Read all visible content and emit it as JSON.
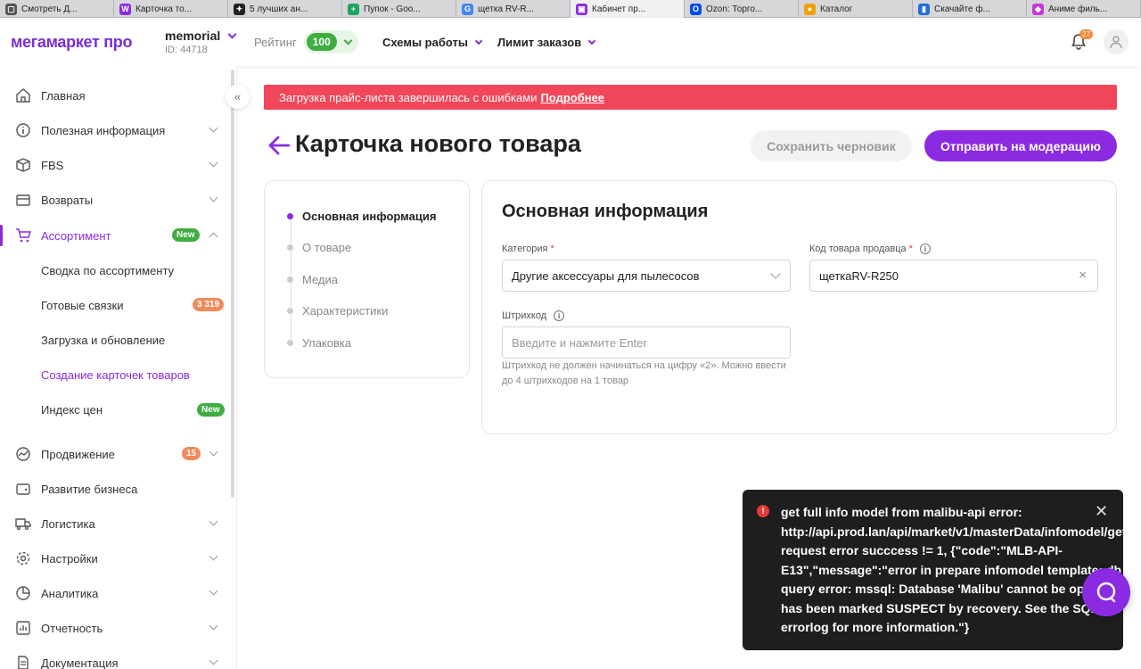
{
  "browser_tabs": [
    {
      "label": "Смотреть Д...",
      "color": "#555555",
      "glyph": "▢"
    },
    {
      "label": "Карточка то...",
      "color": "#8a2be2",
      "glyph": "W"
    },
    {
      "label": "5 лучших ан...",
      "color": "#222222",
      "glyph": "✦"
    },
    {
      "label": "Пупок - Goo...",
      "color": "#1fa463",
      "glyph": "+"
    },
    {
      "label": "щетка RV-R...",
      "color": "#4285f4",
      "glyph": "G"
    },
    {
      "label": "Кабинет пр...",
      "color": "#8a2be2",
      "glyph": "▣"
    },
    {
      "label": "Ozon: Торго...",
      "color": "#0050e0",
      "glyph": "O"
    },
    {
      "label": "Каталог",
      "color": "#f2a10a",
      "glyph": "●"
    },
    {
      "label": "Скачайте ф...",
      "color": "#1e6fd9",
      "glyph": "▮"
    },
    {
      "label": "Аниме филь...",
      "color": "#c43ad6",
      "glyph": "◆"
    }
  ],
  "header": {
    "logo": "мегамаркет про",
    "store_name": "memorial",
    "store_id": "ID: 44718",
    "rating_label": "Рейтинг",
    "rating_value": "100",
    "nav_schemes": "Схемы работы",
    "nav_limit": "Лимит заказов",
    "notifications_count": "27"
  },
  "sidebar": {
    "items": [
      {
        "label": "Главная",
        "icon": "home-icon"
      },
      {
        "label": "Полезная информация",
        "icon": "info-icon"
      },
      {
        "label": "FBS",
        "icon": "box-icon"
      },
      {
        "label": "Возвраты",
        "icon": "return-icon"
      },
      {
        "label": "Ассортимент",
        "icon": "cart-icon",
        "badge": "New"
      },
      {
        "label": "Продвижение",
        "icon": "chart-icon",
        "badge": "15"
      },
      {
        "label": "Развитие бизнеса",
        "icon": "wallet-icon"
      },
      {
        "label": "Логистика",
        "icon": "truck-icon"
      },
      {
        "label": "Настройки",
        "icon": "gear-icon"
      },
      {
        "label": "Аналитика",
        "icon": "analytics-icon"
      },
      {
        "label": "Отчетность",
        "icon": "report-icon"
      },
      {
        "label": "Документация",
        "icon": "document-icon"
      }
    ],
    "subitems": [
      {
        "label": "Сводка по ассортименту"
      },
      {
        "label": "Готовые связки",
        "badge": "3 319"
      },
      {
        "label": "Загрузка и обновление"
      },
      {
        "label": "Создание карточек товаров"
      },
      {
        "label": "Индекс цен",
        "badge": "New"
      }
    ]
  },
  "alert": {
    "text": "Загрузка прайс-листа завершилась с ошибками",
    "link": "Подробнее"
  },
  "page": {
    "title": "Карточка нового товара",
    "save_draft": "Сохранить черновик",
    "send_moderation": "Отправить на модерацию"
  },
  "steps": [
    {
      "label": "Основная информация"
    },
    {
      "label": "О товаре"
    },
    {
      "label": "Медиа"
    },
    {
      "label": "Характеристики"
    },
    {
      "label": "Упаковка"
    }
  ],
  "form": {
    "title": "Основная информация",
    "category_label": "Категория",
    "category_value": "Другие аксессуары для пылесосов",
    "seller_code_label": "Код товара продавца",
    "seller_code_value": "щеткаRV-R250",
    "barcode_label": "Штрихкод",
    "barcode_placeholder": "Введите и нажмите Enter",
    "barcode_hint": "Штрихкод не должен начинаться на цифру «2». Можно ввести до 4 штрихкодов на 1 товар",
    "required_mark": "*"
  },
  "toast": {
    "message": "get full info model from malibu-api error:\nhttp://api.prod.lan/api/market/v1/masterData/infomodel/get\nrequest error succcess != 1, {\"code\":\"MLB-API-\nE13\",\"message\":\"error in prepare infomodel template: db\nquery error: mssql: Database 'Malibu' cannot be opened. It\nhas been marked SUSPECT by recovery. See the SQL Server\nerrorlog for more information.\"}"
  },
  "colors": {
    "accent": "#8a2be2",
    "alert": "#f2475a",
    "success": "#3fad3f"
  }
}
